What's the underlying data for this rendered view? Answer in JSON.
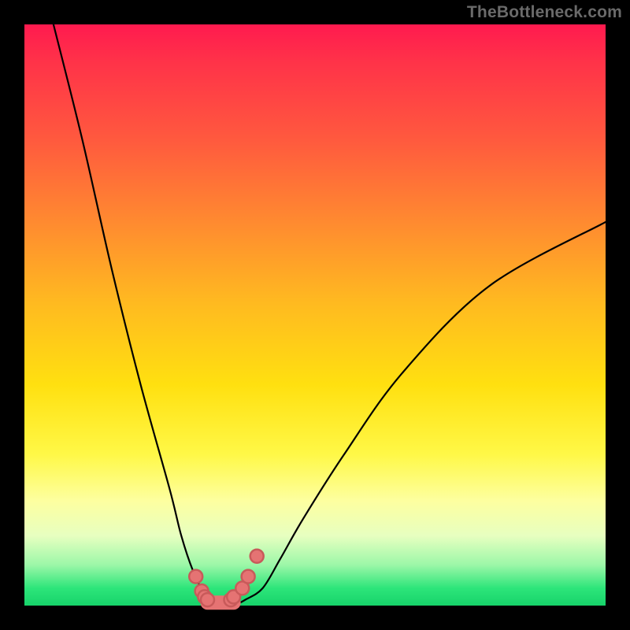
{
  "watermark": "TheBottleneck.com",
  "chart_data": {
    "type": "line",
    "title": "",
    "xlabel": "",
    "ylabel": "",
    "xlim": [
      0,
      100
    ],
    "ylim": [
      0,
      100
    ],
    "grid": false,
    "series": [
      {
        "name": "bottleneck-curve",
        "x": [
          5,
          10,
          15,
          20,
          25,
          27,
          29,
          31,
          33,
          35,
          36,
          38,
          41,
          44,
          48,
          55,
          65,
          80,
          100
        ],
        "y": [
          100,
          80,
          58,
          38,
          20,
          12,
          6,
          2,
          0,
          0,
          0,
          1,
          3,
          8,
          15,
          26,
          40,
          55,
          66
        ]
      }
    ],
    "highlighted_points": {
      "name": "near-zero-markers",
      "x": [
        29.5,
        30.5,
        31.0,
        31.5,
        35.5,
        36.0,
        37.5,
        38.5,
        40.0
      ],
      "y": [
        5.0,
        2.5,
        1.5,
        1.0,
        1.0,
        1.5,
        3.0,
        5.0,
        8.5
      ]
    },
    "flat_segment": {
      "x_start": 31.5,
      "x_end": 36.0,
      "y": 0.5
    },
    "colors": {
      "curve": "#000000",
      "marker_fill": "#e57373",
      "marker_stroke": "#c85a5a",
      "gradient_top": "#ff1a4f",
      "gradient_bottom": "#17d36a"
    }
  }
}
